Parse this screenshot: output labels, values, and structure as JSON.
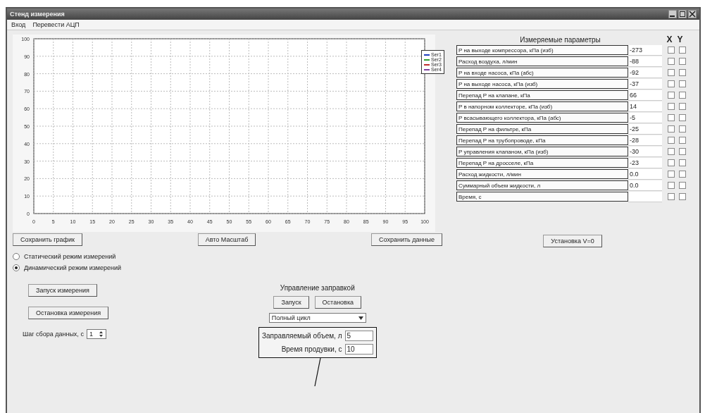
{
  "window": {
    "title": "Стенд измерения"
  },
  "menu": [
    "Вход",
    "Перевести АЦП"
  ],
  "chart": {
    "chart_data": {
      "type": "line",
      "grid": true,
      "categories": [
        "0",
        "5",
        "10",
        "15",
        "20",
        "25",
        "30",
        "35",
        "40",
        "45",
        "50",
        "55",
        "60",
        "65",
        "70",
        "75",
        "80",
        "85",
        "90",
        "95",
        "100"
      ],
      "ylim": [
        0,
        100
      ],
      "yticks": [
        0,
        10,
        20,
        30,
        40,
        50,
        60,
        70,
        80,
        90,
        100
      ],
      "series": [
        {
          "name": "Ser1",
          "color": "#1f3fbf",
          "values": [
            null,
            null,
            null,
            null,
            null,
            null,
            null,
            null,
            null,
            null,
            null,
            null,
            null,
            null,
            null,
            null,
            null,
            null,
            null,
            null,
            null
          ]
        },
        {
          "name": "Ser2",
          "color": "#2f9f2f",
          "values": [
            null,
            null,
            null,
            null,
            null,
            null,
            null,
            null,
            null,
            null,
            null,
            null,
            null,
            null,
            null,
            null,
            null,
            null,
            null,
            null,
            null
          ]
        },
        {
          "name": "Ser3",
          "color": "#bf2f2f",
          "values": [
            null,
            null,
            null,
            null,
            null,
            null,
            null,
            null,
            null,
            null,
            null,
            null,
            null,
            null,
            null,
            null,
            null,
            null,
            null,
            null,
            null
          ]
        },
        {
          "name": "Ser4",
          "color": "#7f3f9f",
          "values": [
            null,
            null,
            null,
            null,
            null,
            null,
            null,
            null,
            null,
            null,
            null,
            null,
            null,
            null,
            null,
            null,
            null,
            null,
            null,
            null,
            null
          ]
        }
      ]
    }
  },
  "chart_buttons": [
    "Сохранить график",
    "Авто Масштаб",
    "Сохранить данные"
  ],
  "parameters": {
    "title": "Измеряемые параметры",
    "x_header": "X",
    "y_header": "Y",
    "rows": [
      {
        "name": "P на выходе компрессора, кПа (изб)",
        "value": "-273",
        "x": false,
        "y": false
      },
      {
        "name": "Расход воздуха, л/мин",
        "value": "-88",
        "x": false,
        "y": false
      },
      {
        "name": "P на входе насоса, кПа (абс)",
        "value": "-92",
        "x": false,
        "y": false
      },
      {
        "name": "P на выходе насоса, кПа (изб)",
        "value": "-37",
        "x": false,
        "y": false
      },
      {
        "name": "Перепад P на клапане, кПа",
        "value": "66",
        "x": false,
        "y": false
      },
      {
        "name": "P в напорном коллекторе, кПа (изб)",
        "value": "14",
        "x": false,
        "y": false
      },
      {
        "name": "P всасывающего коллектора, кПа (абс)",
        "value": "-5",
        "x": false,
        "y": false
      },
      {
        "name": "Перепад P на фильтре, кПа",
        "value": "-25",
        "x": false,
        "y": false
      },
      {
        "name": "Перепад P на трубопроводе, кПа",
        "value": "-28",
        "x": false,
        "y": false
      },
      {
        "name": "P управления клапаном, кПа (изб)",
        "value": "-30",
        "x": false,
        "y": false
      },
      {
        "name": "Перепад P на дросселе, кПа",
        "value": "-23",
        "x": false,
        "y": false
      },
      {
        "name": "Расход жидкости, л/мин",
        "value": "0.0",
        "x": false,
        "y": false
      },
      {
        "name": "Суммарный объем жидкости, л",
        "value": "0.0",
        "x": false,
        "y": false
      },
      {
        "name": "Время, с",
        "x": false,
        "y": false
      }
    ]
  },
  "zero_button": "Установка V=0",
  "modes": [
    {
      "label": "Статический режим измерений",
      "selected": false
    },
    {
      "label": "Динамический режим измерений",
      "selected": true
    }
  ],
  "measure_buttons": [
    "Запуск измерения",
    "Остановка измерения"
  ],
  "step": {
    "label": "Шаг сбора данных, с",
    "value": "1"
  },
  "fill": {
    "title": "Управление заправкой",
    "buttons": [
      "Запуск",
      "Остановка"
    ],
    "mode": "Полный цикл",
    "fields": [
      {
        "label": "Заправляемый объем, л",
        "value": "5"
      },
      {
        "label": "Время продувки, с",
        "value": "10"
      }
    ]
  }
}
